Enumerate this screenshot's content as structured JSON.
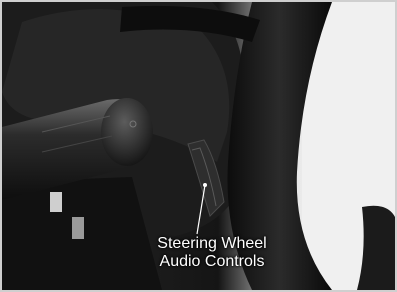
{
  "photo": {
    "subject_icon": "steering-wheel-photo",
    "callout": {
      "line1": "Steering Wheel",
      "line2": "Audio Controls"
    }
  }
}
